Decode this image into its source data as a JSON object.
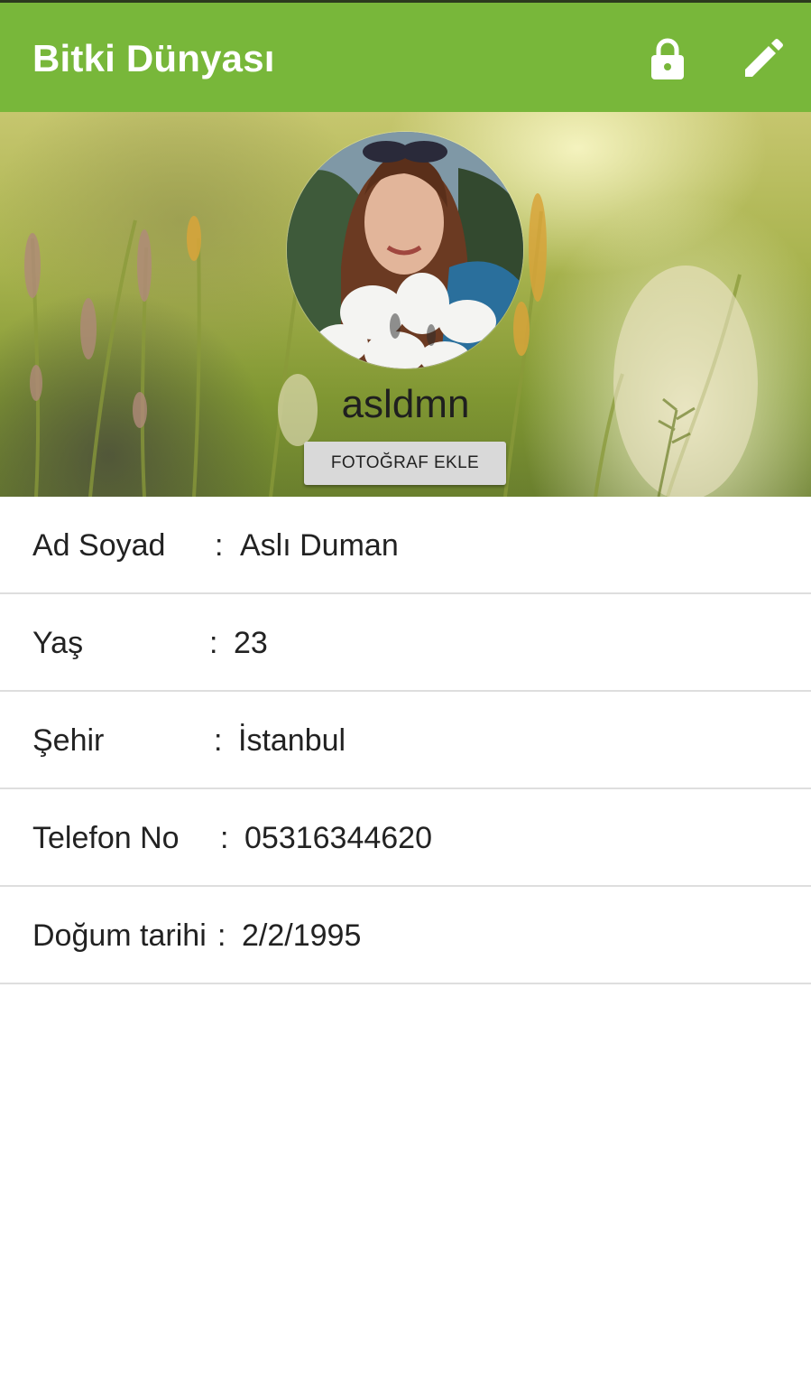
{
  "app_bar": {
    "title": "Bitki Dünyası",
    "color": "#78b73a",
    "actions": [
      {
        "icon": "lock-icon"
      },
      {
        "icon": "pencil-icon"
      }
    ]
  },
  "profile": {
    "username": "asldmn",
    "add_photo_label": "FOTOĞRAF EKLE"
  },
  "info": {
    "rows": [
      {
        "label": "Ad Soyad",
        "separator": ":",
        "value": "Aslı Duman"
      },
      {
        "label": "Yaş",
        "separator": ":",
        "value": "23"
      },
      {
        "label": "Şehir",
        "separator": ":",
        "value": "İstanbul"
      },
      {
        "label": "Telefon No",
        "separator": ":",
        "value": "05316344620"
      },
      {
        "label": "Doğum tarihi",
        "separator": ":",
        "value": "2/2/1995"
      }
    ]
  }
}
